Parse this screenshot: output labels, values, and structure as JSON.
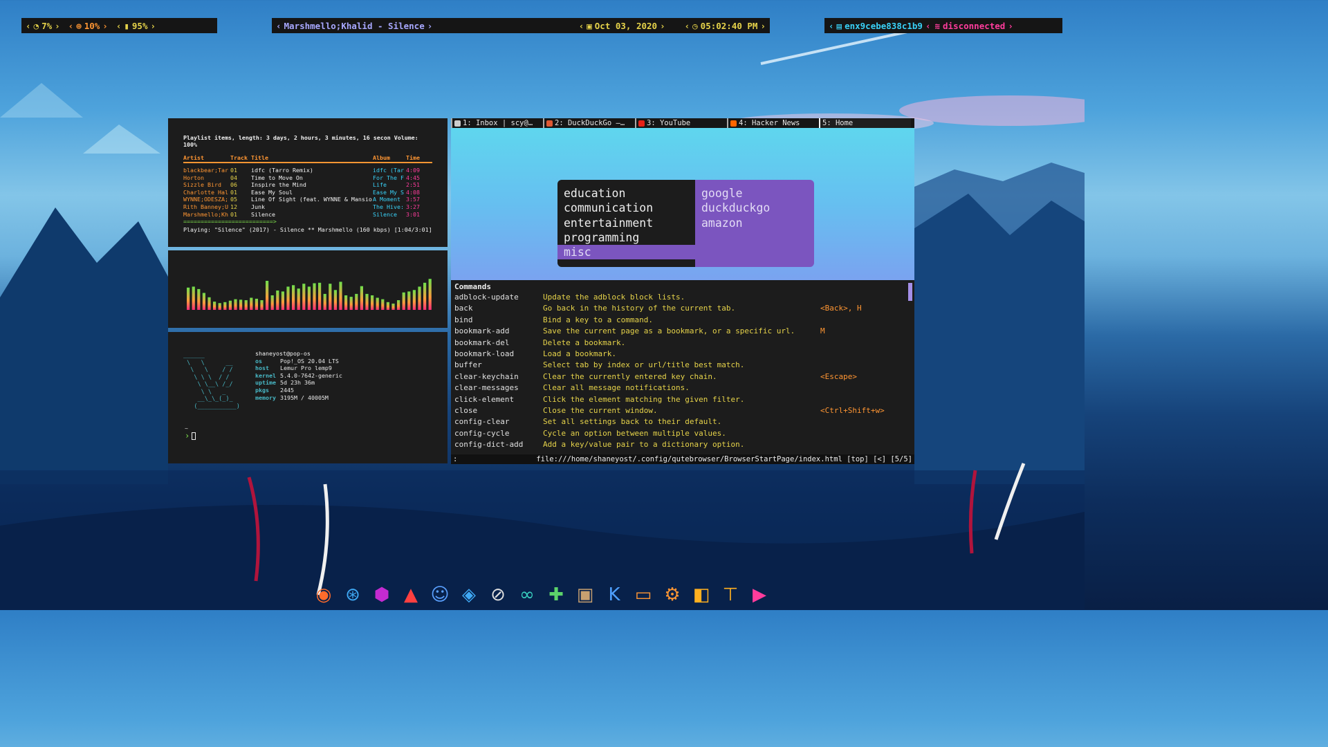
{
  "bar": {
    "cpu": "7%",
    "cpu_icon": "speedometer-icon",
    "mem": "10%",
    "mem_icon": "chip-icon",
    "battery": "95%",
    "battery_icon": "battery-icon",
    "song": "Marshmello;Khalid - Silence",
    "date": "Oct 03, 2020",
    "date_icon": "calendar-icon",
    "time": "05:02:40 PM",
    "time_icon": "clock-icon",
    "iface": "enx9cebe838c1b9",
    "iface_icon": "network-card-icon",
    "wifi": "disconnected",
    "wifi_icon": "wifi-icon"
  },
  "cmus": {
    "header": "Playlist items, length: 3 days, 2 hours, 3 minutes, 16 secon Volume: 100%",
    "col_artist": "Artist",
    "col_track": "Track",
    "col_title": "Title",
    "col_album": "Album",
    "col_time": "Time",
    "tracks": [
      {
        "artist": "blackbear;Tar",
        "track": "01",
        "title": "idfc (Tarro Remix)",
        "album": "idfc (Tar",
        "time": "4:09"
      },
      {
        "artist": "Horton",
        "track": "04",
        "title": "Time to Move On",
        "album": "For The F",
        "time": "4:45"
      },
      {
        "artist": "Sizzle Bird",
        "track": "06",
        "title": "Inspire the Mind",
        "album": "Life",
        "time": "2:51"
      },
      {
        "artist": "Charlotte Hal",
        "track": "01",
        "title": "Ease My Soul",
        "album": "Ease My S",
        "time": "4:08"
      },
      {
        "artist": "WYNNE;ODESZA;",
        "track": "05",
        "title": "Line Of Sight (feat. WYNNE & Mansio",
        "album": "A Moment",
        "time": "3:57"
      },
      {
        "artist": "Rith Banney;U",
        "track": "12",
        "title": "Junk",
        "album": "The Hive:",
        "time": "3:27"
      },
      {
        "artist": "Marshmello;Kh",
        "track": "01",
        "title": "Silence",
        "album": "Silence",
        "time": "3:01"
      }
    ],
    "progress": "==========================>",
    "playing": "Playing:  \"Silence\" (2017) - Silence ** Marshmello (160 kbps) [1:04/3:01]"
  },
  "cava": {
    "levels": [
      0.46,
      0.48,
      0.43,
      0.35,
      0.26,
      0.17,
      0.14,
      0.16,
      0.19,
      0.22,
      0.21,
      0.2,
      0.25,
      0.23,
      0.2,
      0.6,
      0.3,
      0.4,
      0.38,
      0.48,
      0.51,
      0.44,
      0.54,
      0.48,
      0.55,
      0.56,
      0.33,
      0.54,
      0.41,
      0.58,
      0.3,
      0.27,
      0.33,
      0.49,
      0.33,
      0.3,
      0.25,
      0.22,
      0.16,
      0.13,
      0.2,
      0.36,
      0.38,
      0.41,
      0.48,
      0.56,
      0.64
    ]
  },
  "neofetch": {
    "ascii": "______\n \\   \\      __\n  \\   \\    / /\n   \\ \\ \\  / /\n    \\ \\__\\ /_/\n     \\ \\   _\n    __\\_\\_(_)_\n   (___________)",
    "userhost": "shaneyost@pop-os",
    "info": [
      {
        "key": "os",
        "val": "Pop!_OS 20.04 LTS"
      },
      {
        "key": "host",
        "val": "Lemur Pro lemp9"
      },
      {
        "key": "kernel",
        "val": "5.4.0-7642-generic"
      },
      {
        "key": "uptime",
        "val": "5d 23h 36m"
      },
      {
        "key": "pkgs",
        "val": "2445"
      },
      {
        "key": "memory",
        "val": "3195M / 40005M"
      }
    ],
    "prompt_dir": "~",
    "prompt": "›"
  },
  "qute": {
    "tabs": [
      {
        "label": "1: Inbox | scy@…",
        "icon": "lock-icon",
        "color": "#cccccc"
      },
      {
        "label": "2: DuckDuckGo —…",
        "icon": "duckduckgo-icon",
        "color": "#de5833"
      },
      {
        "label": "3: YouTube",
        "icon": "youtube-icon",
        "color": "#e62117"
      },
      {
        "label": "4: Hacker News",
        "icon": "ycombinator-icon",
        "color": "#ff6600"
      },
      {
        "label": "5: Home",
        "icon": "",
        "color": ""
      }
    ],
    "menu_left": [
      "education",
      "communication",
      "entertainment",
      "programming",
      "misc"
    ],
    "menu_right": [
      "google",
      "duckduckgo",
      "amazon"
    ],
    "commands_title": "Commands",
    "commands": [
      {
        "name": "adblock-update",
        "desc": "Update the adblock block lists.",
        "key": ""
      },
      {
        "name": "back",
        "desc": "Go back in the history of the current tab.",
        "key": "<Back>, H"
      },
      {
        "name": "bind",
        "desc": "Bind a key to a command.",
        "key": ""
      },
      {
        "name": "bookmark-add",
        "desc": "Save the current page as a bookmark, or a specific url.",
        "key": "M"
      },
      {
        "name": "bookmark-del",
        "desc": "Delete a bookmark.",
        "key": ""
      },
      {
        "name": "bookmark-load",
        "desc": "Load a bookmark.",
        "key": ""
      },
      {
        "name": "buffer",
        "desc": "Select tab by index or url/title best match.",
        "key": ""
      },
      {
        "name": "clear-keychain",
        "desc": "Clear the currently entered key chain.",
        "key": "<Escape>"
      },
      {
        "name": "clear-messages",
        "desc": "Clear all message notifications.",
        "key": ""
      },
      {
        "name": "click-element",
        "desc": "Click the element matching the given filter.",
        "key": ""
      },
      {
        "name": "close",
        "desc": "Close the current window.",
        "key": "<Ctrl+Shift+w>"
      },
      {
        "name": "config-clear",
        "desc": "Set all settings back to their default.",
        "key": ""
      },
      {
        "name": "config-cycle",
        "desc": "Cycle an option between multiple values.",
        "key": ""
      },
      {
        "name": "config-dict-add",
        "desc": "Add a key/value pair to a dictionary option.",
        "key": ""
      }
    ],
    "status_left": ":",
    "status_right": "file:///home/shaneyost/.config/qutebrowser/BrowserStartPage/index.html [top] [<] [5/5]"
  },
  "dock": [
    {
      "name": "firefox-icon",
      "color": "#ff6b2b"
    },
    {
      "name": "steam-alt-icon",
      "color": "#3fa9f5"
    },
    {
      "name": "steam-icon",
      "color": "#c42bd1"
    },
    {
      "name": "vlc-icon",
      "color": "#ff4040"
    },
    {
      "name": "discord-icon",
      "color": "#5aa0ff"
    },
    {
      "name": "vscode-icon",
      "color": "#3fa9f5"
    },
    {
      "name": "compass-icon",
      "color": "#e0e0e0"
    },
    {
      "name": "arduino-icon",
      "color": "#39d1c0"
    },
    {
      "name": "puzzle-icon",
      "color": "#5cd36a"
    },
    {
      "name": "terminal-icon",
      "color": "#c8a070"
    },
    {
      "name": "kite-icon",
      "color": "#4fa0ff"
    },
    {
      "name": "folder-icon",
      "color": "#ff9633"
    },
    {
      "name": "settings-gear-icon",
      "color": "#ff9633"
    },
    {
      "name": "gimp-icon",
      "color": "#ffb020"
    },
    {
      "name": "paint-roller-icon",
      "color": "#ffb020"
    },
    {
      "name": "video-camera-icon",
      "color": "#ff3c9c"
    }
  ]
}
